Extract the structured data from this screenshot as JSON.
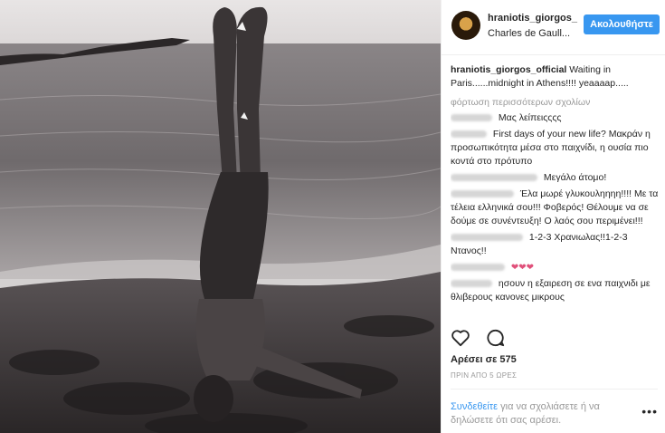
{
  "post": {
    "username": "hraniotis_giorgos_",
    "location": "Charles de Gaull...",
    "follow_label": "Ακολουθήστε",
    "caption": {
      "username": "hraniotis_giorgos_official",
      "text": "Waiting in Paris......midnight in Athens!!!! yeaaaap....."
    },
    "load_more": "φόρτωση περισσότερων σχολίων",
    "comments": [
      {
        "text": "Μας λείπειςςςς"
      },
      {
        "text": "First days of your new life? Μακράν η προσωπικότητα μέσα στο παιχνίδι, η ουσία πιο κοντά στο πρότυπο"
      },
      {
        "text": "Μεγάλο άτομο!"
      },
      {
        "text": "Έλα μωρέ γλυκουληηηη!!!! Με τα τέλεια ελληνικά σου!!! Φοβερός! Θέλουμε να σε δούμε σε συνέντευξη! Ο λαός σου περιμένει!!!"
      },
      {
        "text": "1-2-3 Χρανιωλας!!1-2-3 Ντανος!!"
      },
      {
        "text": "❤❤❤"
      },
      {
        "text": "ησουν η εξαιρεση σε ενα παιχνιδι με θλιβερους κανονες μικρους"
      }
    ],
    "likes": "Αρέσει σε 575",
    "time": "ΠΡΙΝ ΑΠΟ 5 ΩΡΕΣ",
    "login_link": "Συνδεθείτε",
    "login_text": "για να σχολιάσετε ή να δηλώσετε ότι σας αρέσει.",
    "more_dots": "•••"
  },
  "icons": [
    "heart-icon",
    "comment-icon"
  ],
  "colors": {
    "accent": "#3897f0",
    "text": "#262626",
    "muted": "#999999"
  }
}
